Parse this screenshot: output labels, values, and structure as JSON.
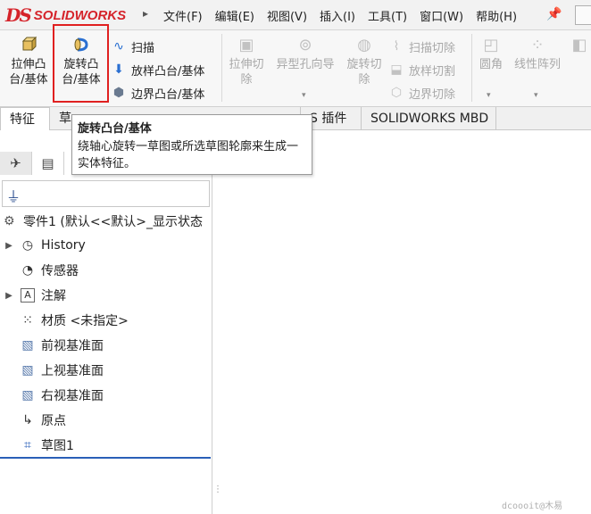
{
  "app": {
    "logo_prefix": "DS",
    "logo_name": "SOLIDWORKS"
  },
  "menu": [
    "文件(F)",
    "编辑(E)",
    "视图(V)",
    "插入(I)",
    "工具(T)",
    "窗口(W)",
    "帮助(H)"
  ],
  "ribbon": {
    "extrude_boss": "拉伸凸\n台/基体",
    "revolve_boss": "旋转凸\n台/基体",
    "sweep": "扫描",
    "loft_boss": "放样凸台/基体",
    "boundary_boss": "边界凸台/基体",
    "extrude_cut": "拉伸切\n除",
    "hole_wizard": "异型孔向导",
    "revolve_cut": "旋转切\n除",
    "sweep_cut": "扫描切除",
    "loft_cut": "放样切割",
    "boundary_cut": "边界切除",
    "fillet": "圆角",
    "linear_pattern": "线性阵列"
  },
  "tabs": {
    "features": "特征",
    "sketch_partial": "草",
    "addins_partial": "S 插件",
    "mbd": "SOLIDWORKS MBD"
  },
  "tooltip": {
    "title": "旋转凸台/基体",
    "body": "绕轴心旋转一草图或所选草图轮廓来生成一实体特征。"
  },
  "tree": {
    "root": "零件1 (默认<<默认>_显示状态",
    "items": [
      {
        "label": "History",
        "icon": "history-icon",
        "expandable": true
      },
      {
        "label": "传感器",
        "icon": "sensor-icon",
        "expandable": false
      },
      {
        "label": "注解",
        "icon": "annotation-icon",
        "expandable": true
      },
      {
        "label": "材质 <未指定>",
        "icon": "material-icon",
        "expandable": false
      },
      {
        "label": "前视基准面",
        "icon": "plane-icon",
        "expandable": false
      },
      {
        "label": "上视基准面",
        "icon": "plane-icon",
        "expandable": false
      },
      {
        "label": "右视基准面",
        "icon": "plane-icon",
        "expandable": false
      },
      {
        "label": "原点",
        "icon": "origin-icon",
        "expandable": false
      },
      {
        "label": "草图1",
        "icon": "sketch-icon",
        "expandable": false
      }
    ]
  },
  "watermark": "dcoooit@木易",
  "colors": {
    "brand": "#d5232a",
    "highlight": "#e02020",
    "accent": "#2a5fb8"
  }
}
